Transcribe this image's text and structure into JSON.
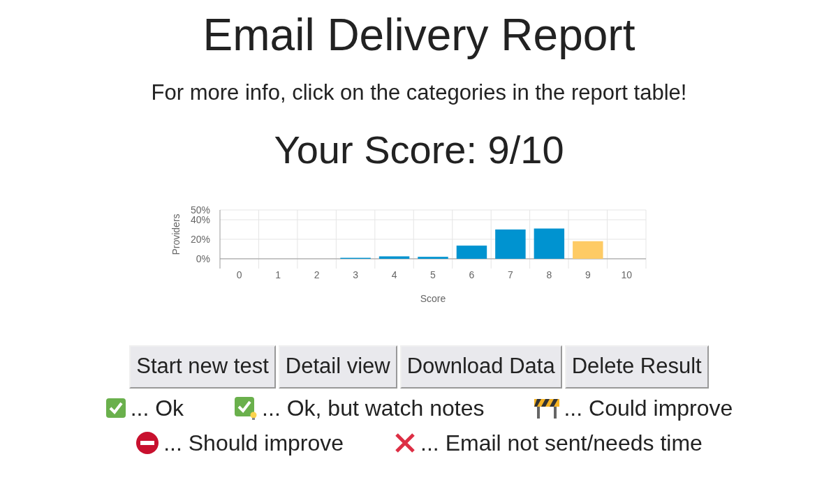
{
  "title": "Email Delivery Report",
  "subtitle": "For more info, click on the categories in the report table!",
  "score": "Your Score: 9/10",
  "chart_data": {
    "type": "bar",
    "xlabel": "Score",
    "ylabel": "Providers",
    "categories": [
      "0",
      "1",
      "2",
      "3",
      "4",
      "5",
      "6",
      "7",
      "8",
      "9",
      "10"
    ],
    "series": [
      {
        "color": "#0093d0",
        "values": [
          0,
          0,
          0,
          1,
          2.5,
          2,
          13.5,
          30,
          31,
          null,
          0
        ]
      },
      {
        "color": "#fecb65",
        "values": [
          null,
          null,
          null,
          null,
          null,
          null,
          null,
          null,
          null,
          18,
          null
        ]
      }
    ],
    "stacked": true,
    "ylim": [
      0,
      50
    ],
    "yticks": [
      {
        "value": 0,
        "label": "0%"
      },
      {
        "value": 20,
        "label": "20%"
      },
      {
        "value": 40,
        "label": "40%"
      },
      {
        "value": 50,
        "label": "50%"
      }
    ]
  },
  "buttons": [
    "Start new test",
    "Detail view",
    "Download Data",
    "Delete Result"
  ],
  "legend_rows": [
    [
      {
        "kind": "check",
        "label": "... Ok"
      },
      {
        "kind": "check-bulb",
        "label": "... Ok, but watch notes"
      },
      {
        "kind": "barrier",
        "label": "... Could improve"
      }
    ],
    [
      {
        "kind": "no-entry",
        "label": "... Should improve"
      },
      {
        "kind": "cross",
        "label": "... Email not sent/needs time"
      }
    ]
  ]
}
